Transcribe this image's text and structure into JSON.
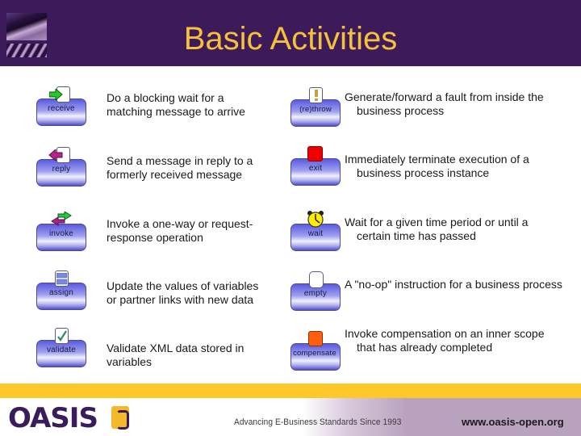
{
  "header": {
    "title": "Basic Activities",
    "logo_icon": "decorative-image-icon"
  },
  "left_column": [
    {
      "label": "receive",
      "icon": "inbound-arrow-icon",
      "desc_line1": "Do a blocking wait for a",
      "desc_line2": "matching message to arrive"
    },
    {
      "label": "reply",
      "icon": "outbound-arrow-icon",
      "desc_line1": "Send a message in reply to a",
      "desc_line2": "formerly received message"
    },
    {
      "label": "invoke",
      "icon": "bidirectional-arrows-icon",
      "desc_line1": "Invoke a one-way or request-",
      "desc_line2": "response operation"
    },
    {
      "label": "assign",
      "icon": "assign-icon",
      "desc_line1": "Update the values of variables",
      "desc_line2": "or partner links with new data"
    },
    {
      "label": "validate",
      "icon": "checkmark-icon",
      "desc_line1": "Validate XML data stored in",
      "desc_line2": "variables"
    }
  ],
  "right_column": [
    {
      "label": "(re)throw",
      "icon": "exclamation-icon",
      "desc_line1": "Generate/forward a fault from inside the",
      "desc_line2": "business process"
    },
    {
      "label": "exit",
      "icon": "stop-icon",
      "desc_line1": "Immediately terminate execution of a",
      "desc_line2": "business process instance"
    },
    {
      "label": "wait",
      "icon": "clock-icon",
      "desc_line1": "Wait for a given time period or until a",
      "desc_line2": "certain time has passed"
    },
    {
      "label": "empty",
      "icon": "empty-icon",
      "desc_line1": "A \"no-op\" instruction for a business process",
      "desc_line2": ""
    },
    {
      "label": "compensate",
      "icon": "compensate-icon",
      "desc_line1": "Invoke compensation on an inner scope",
      "desc_line2": "that has already completed"
    }
  ],
  "footer": {
    "logo_text": "OASIS",
    "tagline": "Advancing E-Business Standards Since 1993",
    "url": "www.oasis-open.org"
  },
  "colors": {
    "header_bg": "#3d1b5b",
    "title": "#f5c13a",
    "footer_bar": "#fcc82a",
    "footer_bg": "#b9a2be",
    "exit_red": "#ee0000",
    "compensate_orange": "#ff6010",
    "wait_yellow": "#ffee00"
  }
}
